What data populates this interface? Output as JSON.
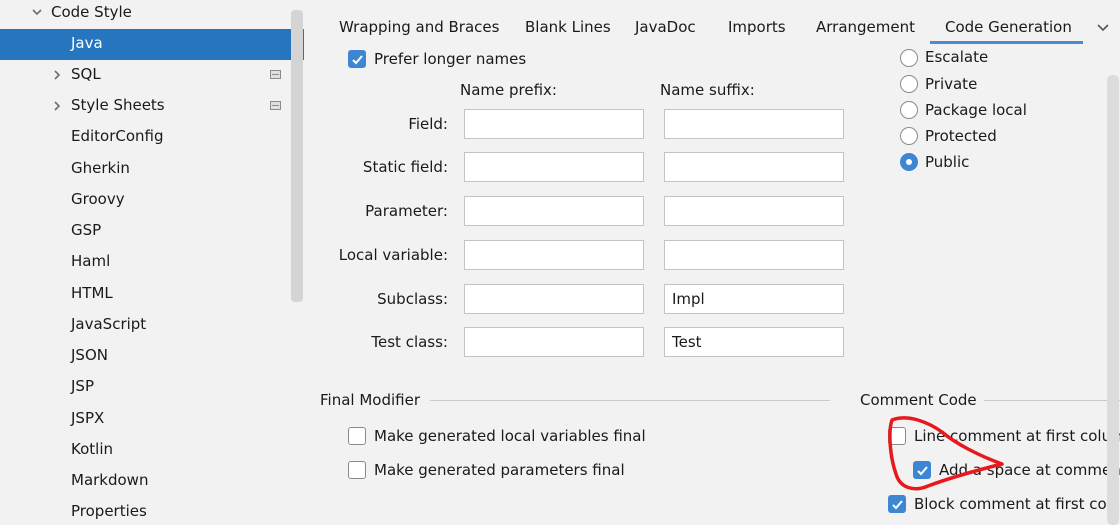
{
  "sidebar": {
    "root_label": "Code Style",
    "items": [
      {
        "label": "Java",
        "selected": true,
        "expandable": false,
        "scheme": false
      },
      {
        "label": "SQL",
        "selected": false,
        "expandable": true,
        "scheme": true
      },
      {
        "label": "Style Sheets",
        "selected": false,
        "expandable": true,
        "scheme": true
      },
      {
        "label": "EditorConfig",
        "selected": false,
        "expandable": false,
        "scheme": false
      },
      {
        "label": "Gherkin",
        "selected": false,
        "expandable": false,
        "scheme": false
      },
      {
        "label": "Groovy",
        "selected": false,
        "expandable": false,
        "scheme": false
      },
      {
        "label": "GSP",
        "selected": false,
        "expandable": false,
        "scheme": false
      },
      {
        "label": "Haml",
        "selected": false,
        "expandable": false,
        "scheme": false
      },
      {
        "label": "HTML",
        "selected": false,
        "expandable": false,
        "scheme": false
      },
      {
        "label": "JavaScript",
        "selected": false,
        "expandable": false,
        "scheme": false
      },
      {
        "label": "JSON",
        "selected": false,
        "expandable": false,
        "scheme": false
      },
      {
        "label": "JSP",
        "selected": false,
        "expandable": false,
        "scheme": false
      },
      {
        "label": "JSPX",
        "selected": false,
        "expandable": false,
        "scheme": false
      },
      {
        "label": "Kotlin",
        "selected": false,
        "expandable": false,
        "scheme": false
      },
      {
        "label": "Markdown",
        "selected": false,
        "expandable": false,
        "scheme": false
      },
      {
        "label": "Properties",
        "selected": false,
        "expandable": false,
        "scheme": false
      }
    ]
  },
  "tabs": [
    {
      "label": "Wrapping and Braces",
      "active": false
    },
    {
      "label": "Blank Lines",
      "active": false
    },
    {
      "label": "JavaDoc",
      "active": false
    },
    {
      "label": "Imports",
      "active": false
    },
    {
      "label": "Arrangement",
      "active": false
    },
    {
      "label": "Code Generation",
      "active": true
    }
  ],
  "naming": {
    "prefer_longer_label": "Prefer longer names",
    "prefer_longer_checked": true,
    "prefix_header": "Name prefix:",
    "suffix_header": "Name suffix:",
    "rows": [
      {
        "label": "Field:",
        "prefix": "",
        "suffix": ""
      },
      {
        "label": "Static field:",
        "prefix": "",
        "suffix": ""
      },
      {
        "label": "Parameter:",
        "prefix": "",
        "suffix": ""
      },
      {
        "label": "Local variable:",
        "prefix": "",
        "suffix": ""
      },
      {
        "label": "Subclass:",
        "prefix": "",
        "suffix": "Impl"
      },
      {
        "label": "Test class:",
        "prefix": "",
        "suffix": "Test"
      }
    ]
  },
  "visibility": {
    "options": [
      {
        "label": "Escalate",
        "checked": false
      },
      {
        "label": "Private",
        "checked": false
      },
      {
        "label": "Package local",
        "checked": false
      },
      {
        "label": "Protected",
        "checked": false
      },
      {
        "label": "Public",
        "checked": true
      }
    ]
  },
  "final_modifier": {
    "title": "Final Modifier",
    "options": [
      {
        "label": "Make generated local variables final",
        "checked": false
      },
      {
        "label": "Make generated parameters final",
        "checked": false
      }
    ]
  },
  "comment_code": {
    "title": "Comment Code",
    "options": [
      {
        "label": "Line comment at first column",
        "checked": false
      },
      {
        "label": "Add a space at comment start",
        "checked": true
      },
      {
        "label": "Block comment at first column",
        "checked": true
      }
    ]
  },
  "colors": {
    "selection": "#2675bf",
    "accent": "#3c86d3",
    "annotation": "#e8181c"
  }
}
